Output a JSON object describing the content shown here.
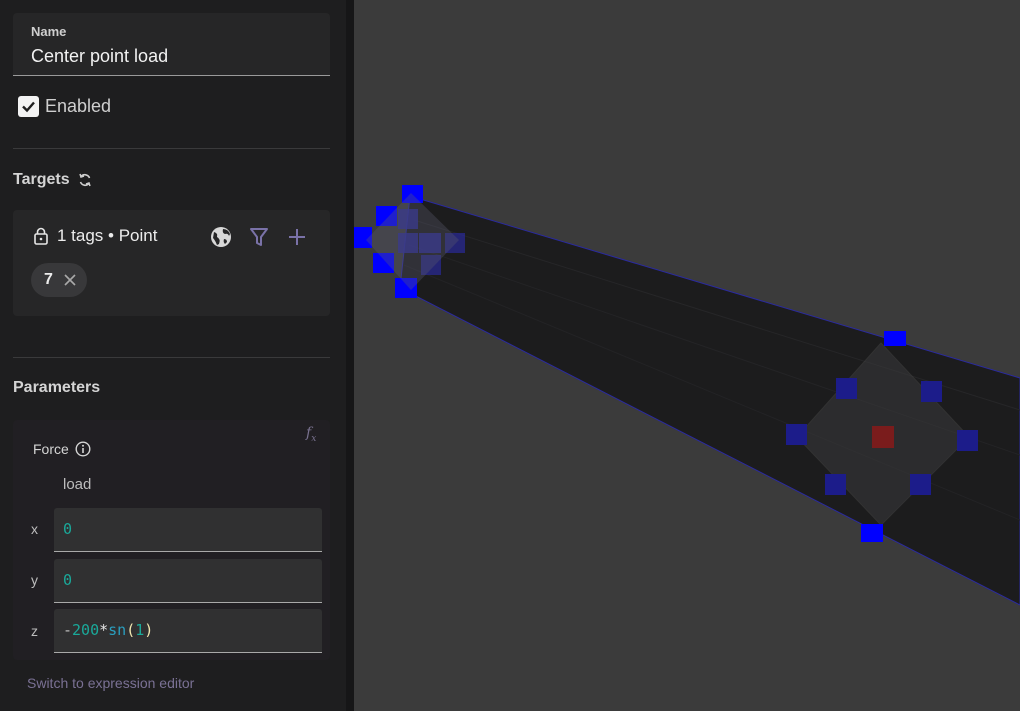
{
  "name_field": {
    "label": "Name",
    "value": "Center point load"
  },
  "enabled": {
    "label": "Enabled",
    "checked": true
  },
  "targets": {
    "title": "Targets",
    "summary": "1 tags • Point",
    "tags": [
      {
        "label": "7"
      }
    ]
  },
  "parameters": {
    "title": "Parameters",
    "force": {
      "label": "Force",
      "sub_label": "load",
      "fields": [
        {
          "axis": "x",
          "expression": "0"
        },
        {
          "axis": "y",
          "expression": "0"
        },
        {
          "axis": "z",
          "expression": "-200*sn(1)"
        }
      ]
    },
    "switch_link": "Switch to expression editor"
  },
  "colors": {
    "accent_purple": "#7a72a8",
    "selection_blue": "#0000ff",
    "highlight_red": "#8a1b1b",
    "code_number": "#1aa99a",
    "code_function": "#2a9fc0"
  }
}
